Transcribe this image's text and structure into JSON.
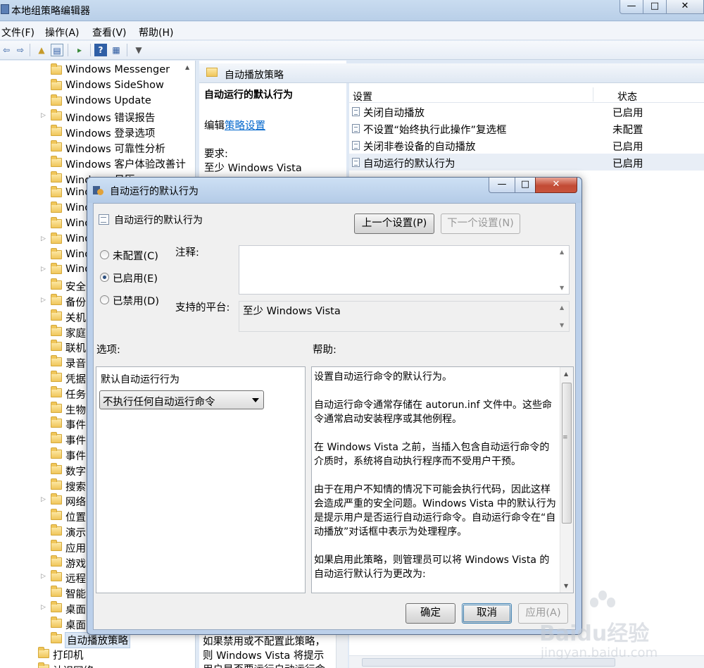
{
  "main_window": {
    "title": "本地组策略编辑器",
    "controls": {
      "minimize": "—",
      "maximize": "□",
      "close": "✕"
    }
  },
  "menu": [
    "文件(F)",
    "操作(A)",
    "查看(V)",
    "帮助(H)"
  ],
  "toolbar_icons": [
    "back-icon",
    "forward-icon",
    "up-folder-icon",
    "show-hide-tree-icon",
    "export-icon",
    "help-icon",
    "properties-icon",
    "filter-icon"
  ],
  "tree": [
    "Windows Messenger",
    "Windows SideShow",
    "Windows Update",
    "Windows 错误报告",
    "Windows 登录选项",
    "Windows 可靠性分析",
    "Windows 客户体验改善计",
    "Windows 日历",
    "Wind",
    "Wind",
    "Wind",
    "Wind",
    "Wind",
    "Wind",
    "安全",
    "备份",
    "关机",
    "家庭",
    "联机",
    "录音",
    "凭据",
    "任务",
    "生物",
    "事件",
    "事件",
    "事件",
    "数字",
    "搜索",
    "网络",
    "位置",
    "演示",
    "应用",
    "游戏",
    "远程",
    "智能",
    "桌面",
    "桌面",
    "自动播放策略",
    "打印机",
    "认识网络"
  ],
  "middle_pane": {
    "header": "自动播放策略",
    "policy_title": "自动运行的默认行为",
    "edit_prefix": "编辑",
    "edit_link": "策略设置",
    "requirement_label": "要求:",
    "requirement_value": "至少 Windows Vista",
    "bottom_text": "如果禁用或不配置此策略，则 Windows Vista 将提示用户是否要运行自动运行命令"
  },
  "list": {
    "col_setting": "设置",
    "col_state": "状态",
    "rows": [
      {
        "name": "关闭自动播放",
        "state": "已启用"
      },
      {
        "name": "不设置“始终执行此操作”复选框",
        "state": "未配置"
      },
      {
        "name": "关闭非卷设备的自动播放",
        "state": "已启用"
      },
      {
        "name": "自动运行的默认行为",
        "state": "已启用"
      }
    ]
  },
  "dialog": {
    "title": "自动运行的默认行为",
    "controls": {
      "minimize": "—",
      "maximize": "□",
      "close": "✕"
    },
    "policy_name": "自动运行的默认行为",
    "prev_button": "上一个设置(P)",
    "next_button": "下一个设置(N)",
    "radios": [
      {
        "label": "未配置(C)",
        "checked": false
      },
      {
        "label": "已启用(E)",
        "checked": true
      },
      {
        "label": "已禁用(D)",
        "checked": false
      }
    ],
    "comment_label": "注释:",
    "comment_value": "",
    "platform_label": "支持的平台:",
    "platform_value": "至少 Windows Vista",
    "options_label": "选项:",
    "help_label": "帮助:",
    "option_field_label": "默认自动运行行为",
    "option_select_value": "不执行任何自动运行命令",
    "help_paragraphs": [
      "设置自动运行命令的默认行为。",
      "自动运行命令通常存储在 autorun.inf 文件中。这些命令通常启动安装程序或其他例程。",
      "在 Windows Vista 之前，当插入包含自动运行命令的介质时，系统将自动执行程序而不受用户干预。",
      "由于在用户不知情的情况下可能会执行代码，因此这样会造成严重的安全问题。Windows Vista 中的默认行为是提示用户是否运行自动运行命令。自动运行命令在“自动播放”对话框中表示为处理程序。",
      "如果启用此策略，则管理员可以将 Windows Vista 的自动运行默认行为更改为:"
    ],
    "ok_button": "确定",
    "cancel_button": "取消",
    "apply_button": "应用(A)"
  },
  "watermark": {
    "brand": "Bai",
    "brand2": "du",
    "brand3": "经验",
    "url": "jingyan.baidu.com"
  }
}
